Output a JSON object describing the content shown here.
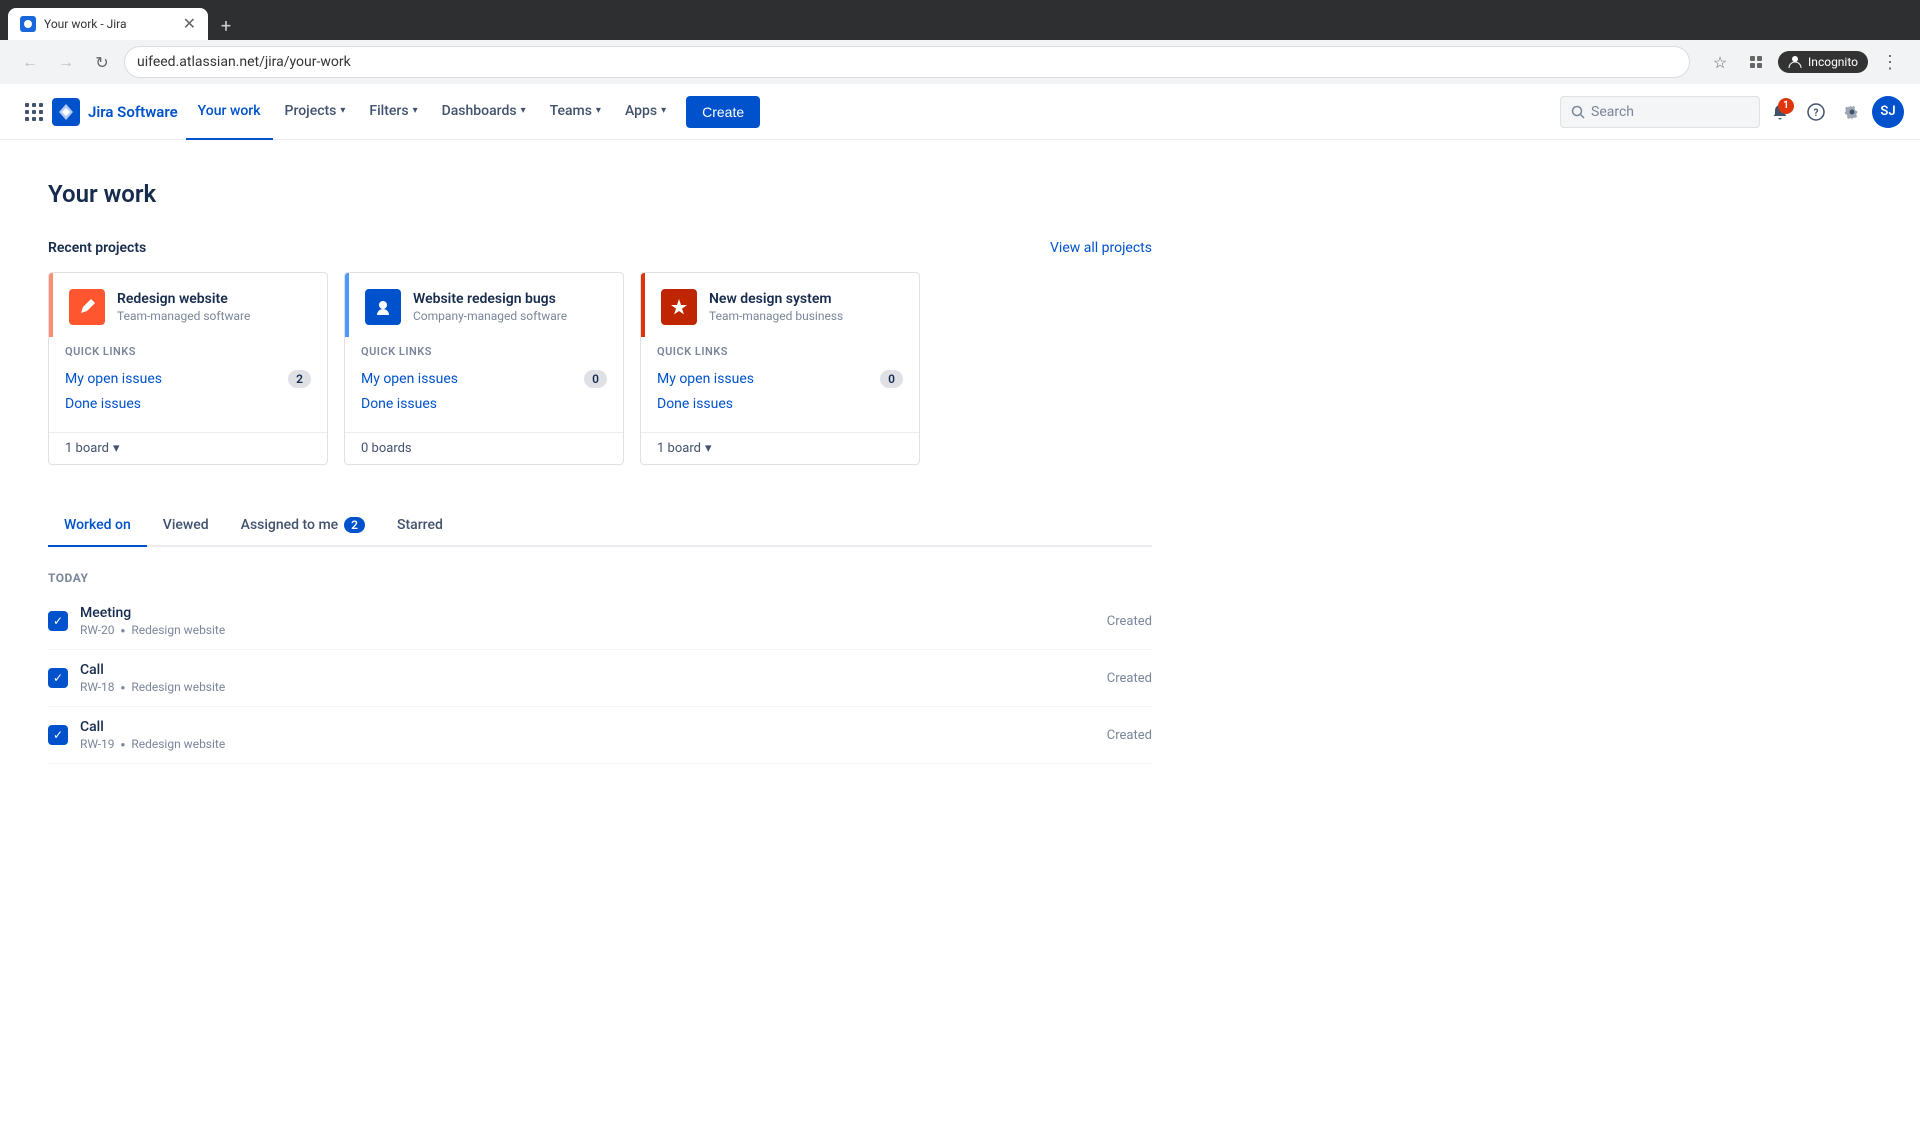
{
  "browser": {
    "tab_title": "Your work - Jira",
    "url": "uifeed.atlassian.net/jira/your-work",
    "incognito_label": "Incognito"
  },
  "nav": {
    "logo_text": "Jira Software",
    "items": [
      {
        "label": "Your work",
        "active": true
      },
      {
        "label": "Projects",
        "has_dropdown": true
      },
      {
        "label": "Filters",
        "has_dropdown": true
      },
      {
        "label": "Dashboards",
        "has_dropdown": true
      },
      {
        "label": "Teams",
        "has_dropdown": true
      },
      {
        "label": "Apps",
        "has_dropdown": true
      }
    ],
    "create_label": "Create",
    "search_placeholder": "Search",
    "notification_count": "1",
    "avatar_initials": "SJ"
  },
  "page": {
    "title": "Your work",
    "recent_projects_label": "Recent projects",
    "view_all_label": "View all projects"
  },
  "projects": [
    {
      "name": "Redesign website",
      "type": "Team-managed software",
      "quick_links_label": "QUICK LINKS",
      "open_issues_label": "My open issues",
      "open_issues_count": "2",
      "done_issues_label": "Done issues",
      "boards_label": "1 board",
      "color_class": "pink",
      "icon_class": "orange",
      "icon_emoji": "🖊"
    },
    {
      "name": "Website redesign bugs",
      "type": "Company-managed software",
      "quick_links_label": "QUICK LINKS",
      "open_issues_label": "My open issues",
      "open_issues_count": "0",
      "done_issues_label": "Done issues",
      "boards_label": "0 boards",
      "color_class": "blue",
      "icon_class": "blue",
      "icon_emoji": "👤"
    },
    {
      "name": "New design system",
      "type": "Team-managed business",
      "quick_links_label": "QUICK LINKS",
      "open_issues_label": "My open issues",
      "open_issues_count": "0",
      "done_issues_label": "Done issues",
      "boards_label": "1 board",
      "color_class": "red",
      "icon_class": "dark-red",
      "icon_emoji": "🔱"
    }
  ],
  "activity_tabs": [
    {
      "label": "Worked on",
      "active": true
    },
    {
      "label": "Viewed",
      "active": false
    },
    {
      "label": "Assigned to me",
      "badge": "2",
      "active": false
    },
    {
      "label": "Starred",
      "active": false
    }
  ],
  "today_label": "TODAY",
  "issues": [
    {
      "title": "Meeting",
      "id": "RW-20",
      "project": "Redesign website",
      "action": "Created"
    },
    {
      "title": "Call",
      "id": "RW-18",
      "project": "Redesign website",
      "action": "Created"
    },
    {
      "title": "Call",
      "id": "RW-19",
      "project": "Redesign website",
      "action": "Created"
    }
  ]
}
